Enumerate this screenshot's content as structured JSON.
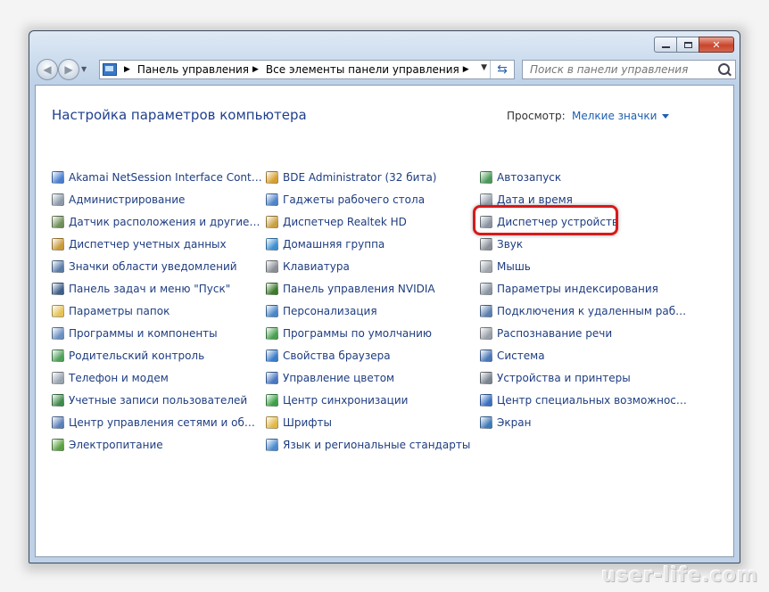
{
  "window": {
    "address_parts": [
      "Панель управления",
      "Все элементы панели управления"
    ],
    "search_placeholder": "Поиск в панели управления"
  },
  "header": {
    "title": "Настройка параметров компьютера",
    "view_by_label": "Просмотр:",
    "view_by_value": "Мелкие значки"
  },
  "columns": [
    [
      {
        "label": "Akamai NetSession Interface Control...",
        "icon": "akamai-icon",
        "color": "#4a7fd0"
      },
      {
        "label": "Администрирование",
        "icon": "admin-tools-icon",
        "color": "#8c9aa8"
      },
      {
        "label": "Датчик расположения и другие дат...",
        "icon": "location-sensor-icon",
        "color": "#6f8f5a"
      },
      {
        "label": "Диспетчер учетных данных",
        "icon": "credential-manager-icon",
        "color": "#c89a3a"
      },
      {
        "label": "Значки области уведомлений",
        "icon": "notification-icons-icon",
        "color": "#5a7ca8"
      },
      {
        "label": "Панель задач и меню \"Пуск\"",
        "icon": "taskbar-icon",
        "color": "#3d5f8a"
      },
      {
        "label": "Параметры папок",
        "icon": "folder-options-icon",
        "color": "#e5c255"
      },
      {
        "label": "Программы и компоненты",
        "icon": "programs-icon",
        "color": "#6a8fc0"
      },
      {
        "label": "Родительский контроль",
        "icon": "parental-control-icon",
        "color": "#4fa05a"
      },
      {
        "label": "Телефон и модем",
        "icon": "phone-modem-icon",
        "color": "#9aa4b0"
      },
      {
        "label": "Учетные записи пользователей",
        "icon": "user-accounts-icon",
        "color": "#3f8a4a"
      },
      {
        "label": "Центр управления сетями и общи...",
        "icon": "network-center-icon",
        "color": "#5b7fb8"
      },
      {
        "label": "Электропитание",
        "icon": "power-options-icon",
        "color": "#5ba043"
      }
    ],
    [
      {
        "label": "BDE Administrator (32 бита)",
        "icon": "bde-admin-icon",
        "color": "#d8a030"
      },
      {
        "label": "Гаджеты рабочего стола",
        "icon": "gadgets-icon",
        "color": "#4f83c8"
      },
      {
        "label": "Диспетчер Realtek HD",
        "icon": "realtek-icon",
        "color": "#c8a040"
      },
      {
        "label": "Домашняя группа",
        "icon": "homegroup-icon",
        "color": "#3f8fd0"
      },
      {
        "label": "Клавиатура",
        "icon": "keyboard-icon",
        "color": "#8a8f96"
      },
      {
        "label": "Панель управления NVIDIA",
        "icon": "nvidia-icon",
        "color": "#3d7a2a"
      },
      {
        "label": "Персонализация",
        "icon": "personalization-icon",
        "color": "#4a86c8"
      },
      {
        "label": "Программы по умолчанию",
        "icon": "default-programs-icon",
        "color": "#48a050"
      },
      {
        "label": "Свойства браузера",
        "icon": "internet-options-icon",
        "color": "#3b7cc8"
      },
      {
        "label": "Управление цветом",
        "icon": "color-management-icon",
        "color": "#4a78c0"
      },
      {
        "label": "Центр синхронизации",
        "icon": "sync-center-icon",
        "color": "#3da048"
      },
      {
        "label": "Шрифты",
        "icon": "fonts-icon",
        "color": "#e0b845"
      },
      {
        "label": "Язык и региональные стандарты",
        "icon": "region-language-icon",
        "color": "#4a8ad0"
      }
    ],
    [
      {
        "label": "Автозапуск",
        "icon": "autoplay-icon",
        "color": "#4a9a58"
      },
      {
        "label": "Дата и время",
        "icon": "date-time-icon",
        "color": "#9aa4b0"
      },
      {
        "label": "Диспетчер устройств",
        "icon": "device-manager-icon",
        "color": "#8a94a0"
      },
      {
        "label": "Звук",
        "icon": "sound-icon",
        "color": "#8a9098"
      },
      {
        "label": "Мышь",
        "icon": "mouse-icon",
        "color": "#a0a6ac"
      },
      {
        "label": "Параметры индексирования",
        "icon": "indexing-icon",
        "color": "#8a96a4"
      },
      {
        "label": "Подключения к удаленным рабоч...",
        "icon": "remote-desktop-icon",
        "color": "#5a7fb0"
      },
      {
        "label": "Распознавание речи",
        "icon": "speech-icon",
        "color": "#9aa0a8"
      },
      {
        "label": "Система",
        "icon": "system-icon",
        "color": "#4a78b8"
      },
      {
        "label": "Устройства и принтеры",
        "icon": "devices-printers-icon",
        "color": "#7a8490"
      },
      {
        "label": "Центр специальных возможностей",
        "icon": "ease-of-access-icon",
        "color": "#3a6fc0"
      },
      {
        "label": "Экран",
        "icon": "display-icon",
        "color": "#3f7ab8"
      }
    ]
  ],
  "highlight": {
    "target": "Диспетчер устройств",
    "color": "#d8191a"
  },
  "watermark": "user-life.com"
}
